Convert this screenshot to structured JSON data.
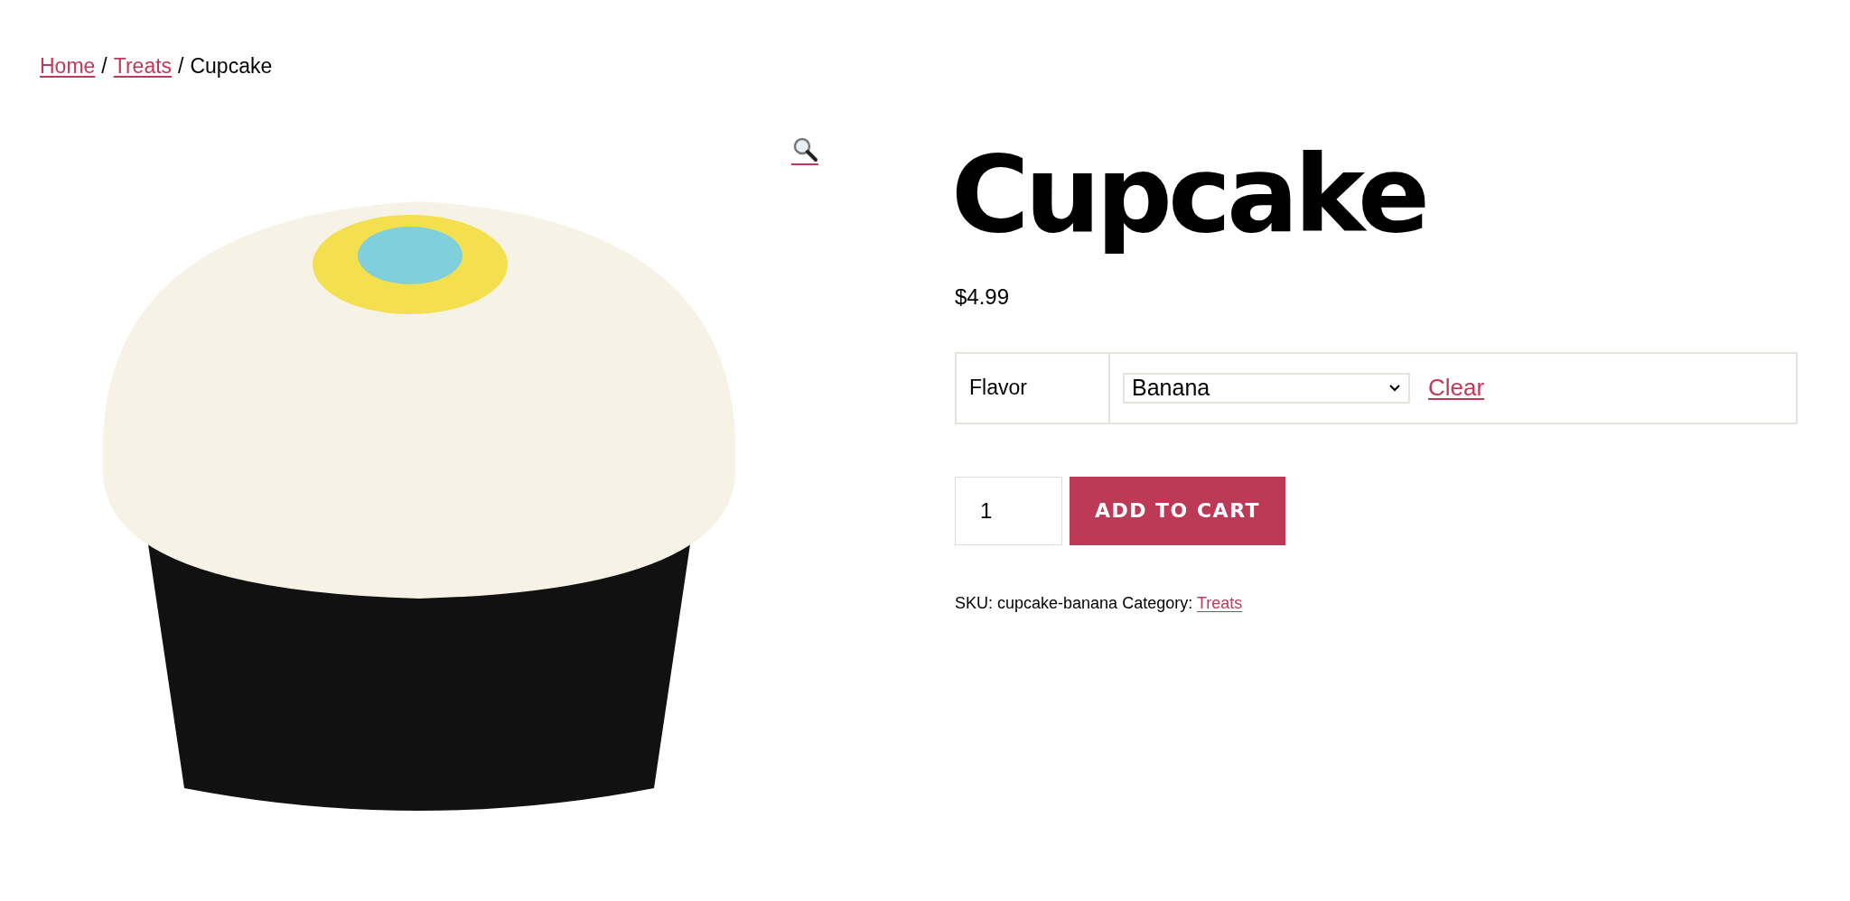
{
  "breadcrumb": {
    "links": [
      "Home",
      "Treats"
    ],
    "separator": "/",
    "current": "Cupcake"
  },
  "product": {
    "title": "Cupcake",
    "price": "$4.99",
    "variations": [
      {
        "label": "Flavor",
        "value": "Banana",
        "clear": "Clear"
      }
    ],
    "quantity": "1",
    "add_to_cart": "ADD TO CART",
    "meta": {
      "sku_label": "SKU:",
      "sku": "cupcake-banana",
      "category_label": "Category:",
      "category": "Treats"
    }
  }
}
